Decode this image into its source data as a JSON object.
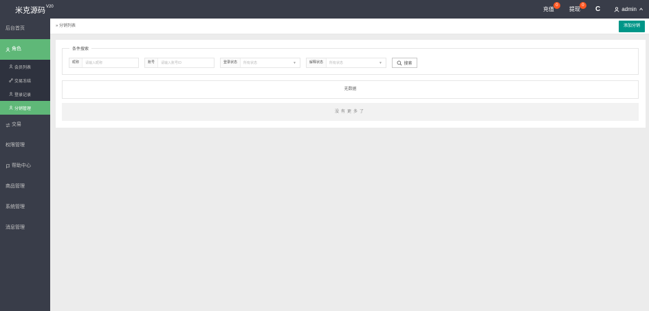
{
  "header": {
    "logo_text": "米克源码",
    "logo_version": "V20",
    "recharge_label": "充值",
    "recharge_badge": "0",
    "withdraw_label": "提现",
    "withdraw_badge": "0",
    "refresh_glyph": "C",
    "user_label": "admin"
  },
  "sidebar": {
    "home": "后台首页",
    "role": "角色",
    "role_children": [
      "会员列表",
      "交易冻结",
      "登录记录",
      "分销管理"
    ],
    "items": [
      "交易",
      "权限管理",
      "帮助中心",
      "商品管理",
      "系统管理",
      "消息管理"
    ]
  },
  "breadcrumb": {
    "separator": "»",
    "current": "分销列表",
    "add_button": "添加分销"
  },
  "search": {
    "legend": "条件搜索",
    "fields": [
      {
        "label": "昵称",
        "placeholder": "请输入昵称"
      },
      {
        "label": "账号",
        "placeholder": "请输入账号ID"
      },
      {
        "label": "登录状态",
        "placeholder": "所有状态"
      },
      {
        "label": "解释状态",
        "placeholder": "所有状态"
      }
    ],
    "button": "搜索"
  },
  "table": {
    "empty_text": "无数据",
    "no_more": "没有更多了"
  }
}
